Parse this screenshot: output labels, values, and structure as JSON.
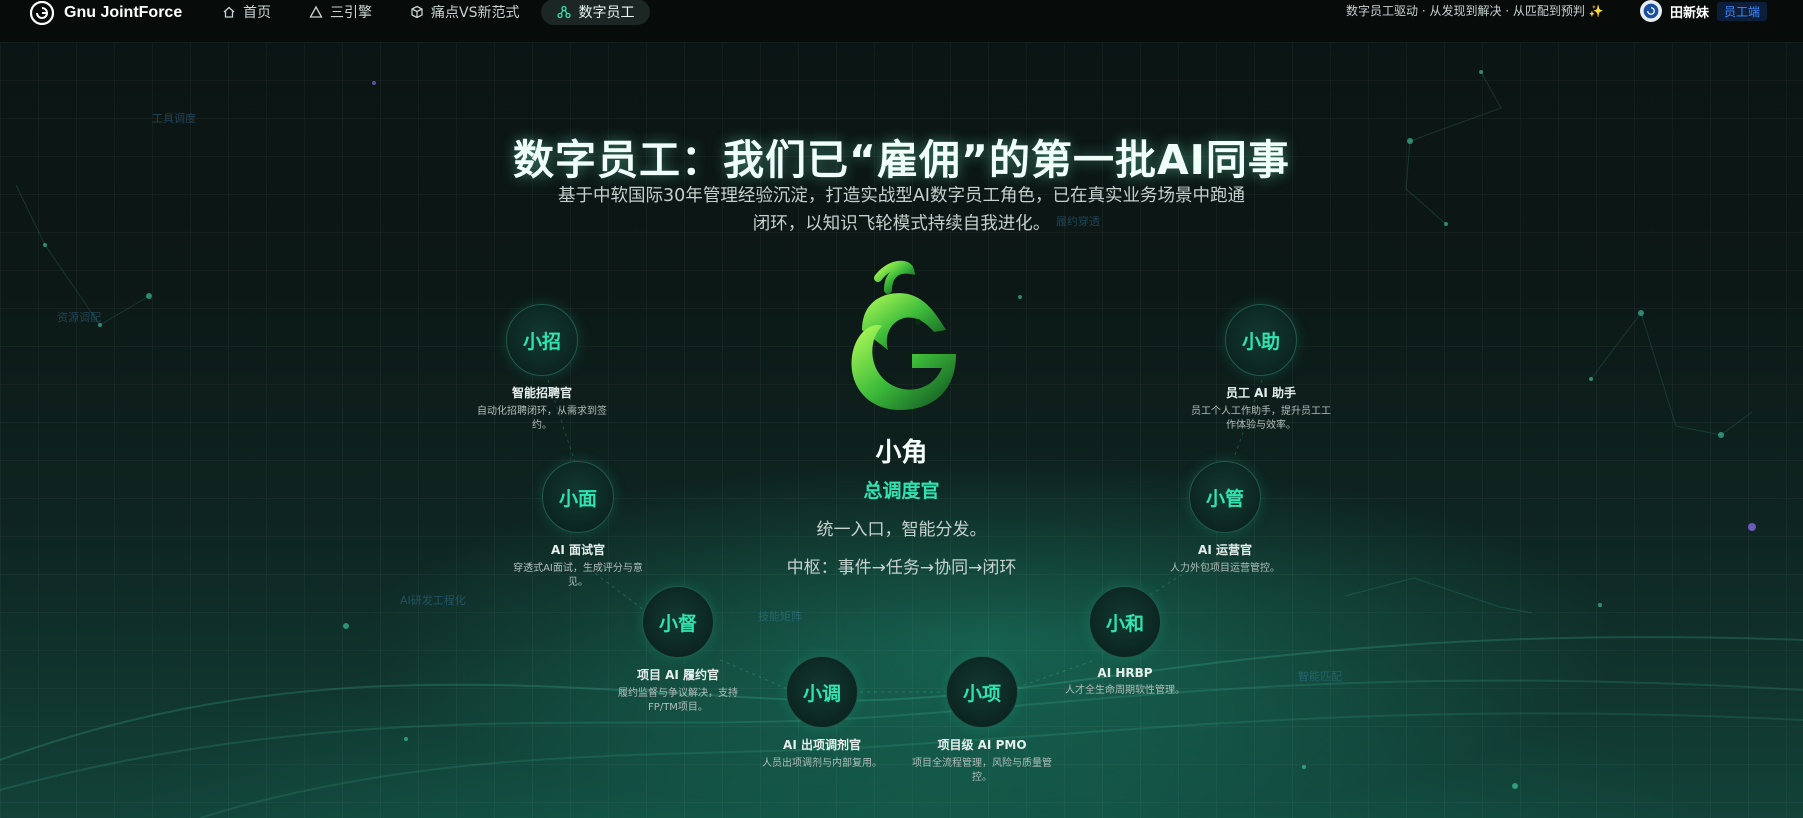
{
  "topbar": {
    "brand": "Gnu JointForce",
    "nav": [
      {
        "label": "首页",
        "icon": "home-icon"
      },
      {
        "label": "三引擎",
        "icon": "triangle-icon"
      },
      {
        "label": "痛点VS新范式",
        "icon": "cube-icon"
      },
      {
        "label": "数字员工",
        "icon": "nodes-icon",
        "active": true
      }
    ],
    "tagline": "数字员工驱动 · 从发现到解决 · 从匹配到预判",
    "user": {
      "name": "田新妹",
      "role_badge": "员工端"
    }
  },
  "hero": {
    "title": "数字员工：我们已“雇佣”的第一批AI同事",
    "subtitle": "基于中软国际30年管理经验沉淀，打造实战型AI数字员工角色，已在真实业务场景中跑通闭环，以知识飞轮模式持续自我进化。"
  },
  "center": {
    "name": "小角",
    "role": "总调度官",
    "desc": "统一入口，智能分发。",
    "flow": "中枢：事件→任务→协同→闭环"
  },
  "agents": [
    {
      "name": "小招",
      "title": "智能招聘官",
      "desc": "自动化招聘闭环，从需求到签约。"
    },
    {
      "name": "小助",
      "title": "员工 AI 助手",
      "desc": "员工个人工作助手，提升员工工作体验与效率。"
    },
    {
      "name": "小面",
      "title": "AI 面试官",
      "desc": "穿透式AI面试，生成评分与意见。"
    },
    {
      "name": "小管",
      "title": "AI 运营官",
      "desc": "人力外包项目运营管控。"
    },
    {
      "name": "小督",
      "title": "项目 AI 履约官",
      "desc": "履约监督与争议解决，支持FP/TM项目。"
    },
    {
      "name": "小和",
      "title": "AI HRBP",
      "desc": "人才全生命周期软性管理。"
    },
    {
      "name": "小调",
      "title": "AI 出项调剂官",
      "desc": "人员出项调剂与内部复用。"
    },
    {
      "name": "小项",
      "title": "项目级 AI PMO",
      "desc": "项目全流程管理，风险与质量管控。"
    }
  ],
  "background_labels": [
    "工具调度",
    "资源调配",
    "履约穿透",
    "AI研发工程化",
    "技能矩阵",
    "智能匹配"
  ],
  "colors": {
    "accent": "#32e3b2",
    "badge": "#3d8bff",
    "background": "#0c1816"
  }
}
